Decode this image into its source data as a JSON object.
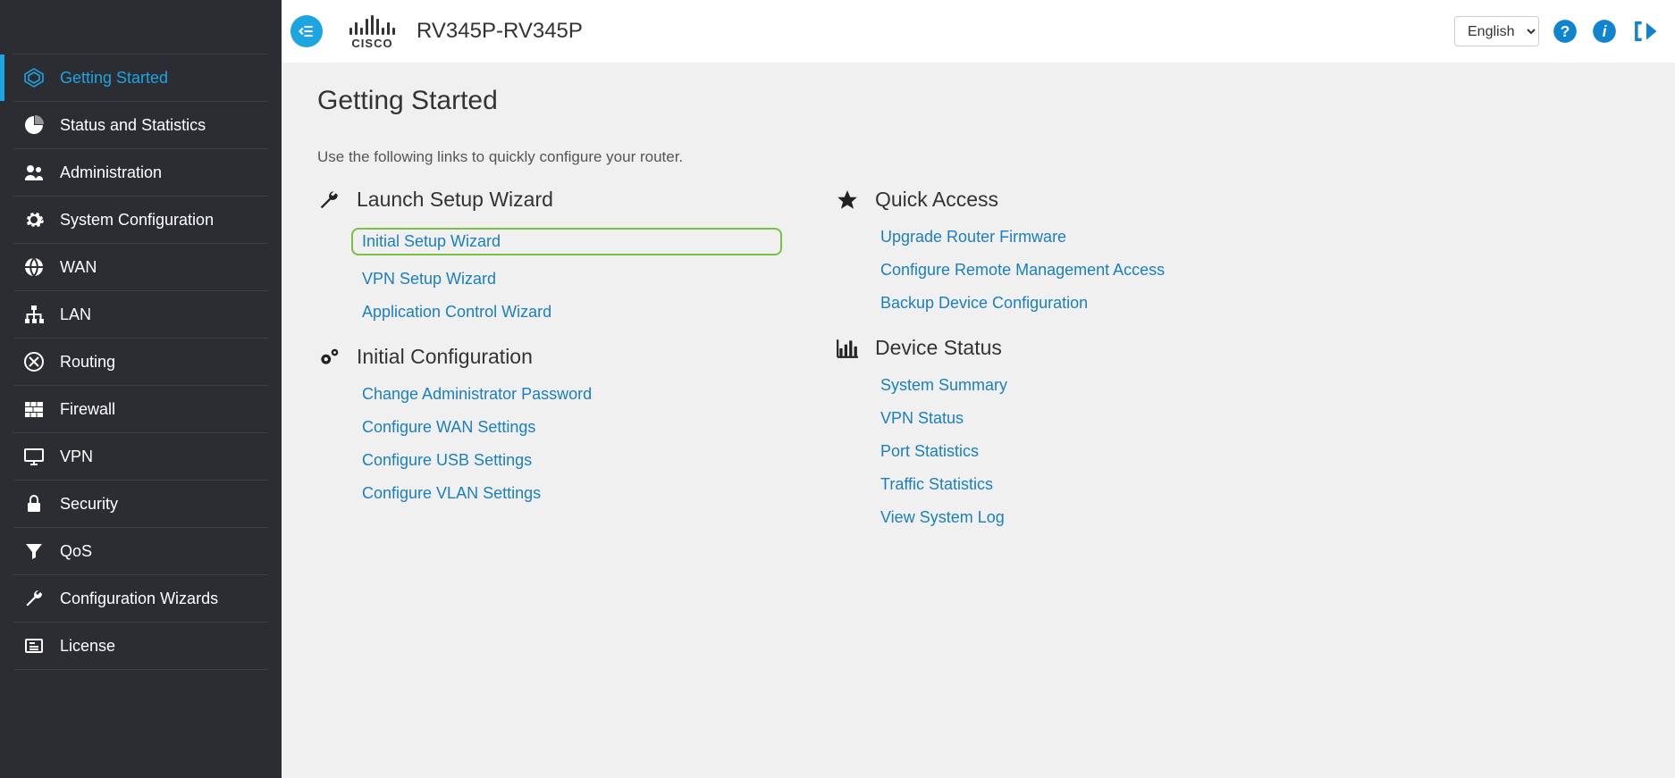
{
  "device_name": "RV345P-RV345P",
  "brand_text": "CISCO",
  "language_selected": "English",
  "page_title": "Getting Started",
  "description": "Use the following links to quickly configure your router.",
  "sidebar": {
    "items": [
      {
        "label": "Getting Started"
      },
      {
        "label": "Status and Statistics"
      },
      {
        "label": "Administration"
      },
      {
        "label": "System Configuration"
      },
      {
        "label": "WAN"
      },
      {
        "label": "LAN"
      },
      {
        "label": "Routing"
      },
      {
        "label": "Firewall"
      },
      {
        "label": "VPN"
      },
      {
        "label": "Security"
      },
      {
        "label": "QoS"
      },
      {
        "label": "Configuration Wizards"
      },
      {
        "label": "License"
      }
    ]
  },
  "sections": {
    "launch": {
      "title": "Launch Setup Wizard",
      "links": [
        "Initial Setup Wizard",
        "VPN Setup Wizard",
        "Application Control Wizard"
      ]
    },
    "quick": {
      "title": "Quick Access",
      "links": [
        "Upgrade Router Firmware",
        "Configure Remote Management Access",
        "Backup Device Configuration"
      ]
    },
    "initial": {
      "title": "Initial Configuration",
      "links": [
        "Change Administrator Password",
        "Configure WAN Settings",
        "Configure USB Settings",
        "Configure VLAN Settings"
      ]
    },
    "device_status": {
      "title": "Device Status",
      "links": [
        "System Summary",
        "VPN Status",
        "Port Statistics",
        "Traffic Statistics",
        "View System Log"
      ]
    }
  }
}
